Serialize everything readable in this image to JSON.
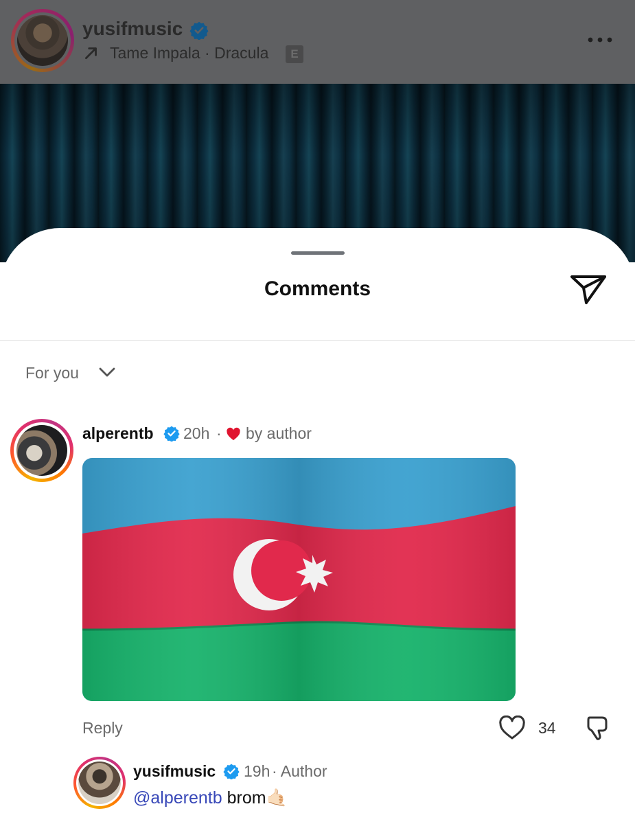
{
  "post_header": {
    "username": "yusifmusic",
    "verified": true,
    "song": "Tame Impala · Dracula",
    "explicit_badge": "E",
    "icons": {
      "verified": "verified-badge-icon",
      "song": "arrow-up-right-icon",
      "more": "more-horizontal-icon"
    }
  },
  "comments_sheet": {
    "title": "Comments",
    "sort": {
      "label": "For you",
      "icon": "chevron-down-icon"
    },
    "share_icon": "send-icon"
  },
  "comments": [
    {
      "username": "alperentb",
      "verified": true,
      "time": "20h",
      "separator": "·",
      "liked_by_author_label": "by author",
      "media": "azerbaijan-flag",
      "reply_label": "Reply",
      "like_count": "34",
      "icons": {
        "heart": "heart-filled-icon",
        "like": "heart-outline-icon",
        "dislike": "thumbs-down-icon"
      }
    }
  ],
  "reply": {
    "username": "yusifmusic",
    "verified": true,
    "time": "19h",
    "author_label": "· Author",
    "mention": "@alperentb",
    "text": " brom",
    "emoji": "🤙🏻"
  },
  "colors": {
    "flag_blue": "#3aa0cf",
    "flag_red": "#e1294c",
    "flag_green": "#17b26b",
    "verified_blue": "#1d9bf0",
    "mention": "#3848b8"
  }
}
